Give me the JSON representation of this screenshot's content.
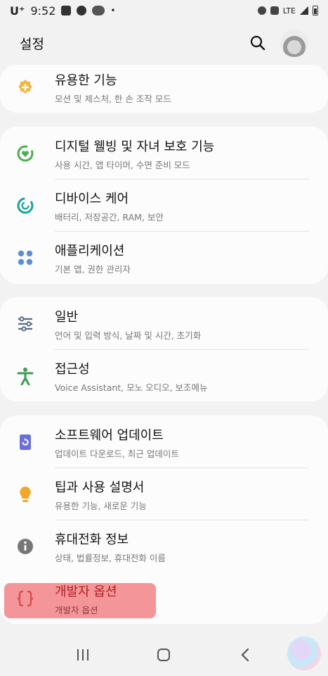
{
  "status_bar": {
    "carrier": "U⁺",
    "time": "9:52",
    "dot": "•",
    "network": "LTE"
  },
  "header": {
    "title": "설정"
  },
  "items": [
    {
      "title": "유용한 기능",
      "subtitle": "모션 및 제스처, 한 손 조작 모드",
      "icon": "plus-badge-icon",
      "color": "#f3b63b"
    },
    {
      "title": "디지털 웰빙 및 자녀 보호 기능",
      "subtitle": "사용 시간, 앱 타이머, 수면 준비 모드",
      "icon": "heart-ring-icon",
      "color": "#4caf50"
    },
    {
      "title": "디바이스 케어",
      "subtitle": "배터리, 저장공간, RAM, 보안",
      "icon": "refresh-ring-icon",
      "color": "#1aa39b"
    },
    {
      "title": "애플리케이션",
      "subtitle": "기본 앱, 권한 관리자",
      "icon": "apps-grid-icon",
      "color": "#5b8fd8"
    },
    {
      "title": "일반",
      "subtitle": "언어 및 입력 방식, 날짜 및 시간, 초기화",
      "icon": "sliders-icon",
      "color": "#5a6b86"
    },
    {
      "title": "접근성",
      "subtitle": "Voice Assistant, 모노 오디오, 보조메뉴",
      "icon": "accessibility-icon",
      "color": "#3f9a54"
    },
    {
      "title": "소프트웨어 업데이트",
      "subtitle": "업데이트 다운로드, 최근 업데이트",
      "icon": "software-update-icon",
      "color": "#6a6fd9"
    },
    {
      "title": "팁과 사용 설명서",
      "subtitle": "유용한 기능, 새로운 기능",
      "icon": "lightbulb-icon",
      "color": "#f4a62a"
    },
    {
      "title": "휴대전화 정보",
      "subtitle": "상태, 법률정보, 휴대전화 이름",
      "icon": "info-icon",
      "color": "#777777"
    },
    {
      "title": "개발자 옵션",
      "subtitle": "개발자 옵션",
      "icon": "braces-icon",
      "color": "#e04949"
    }
  ]
}
